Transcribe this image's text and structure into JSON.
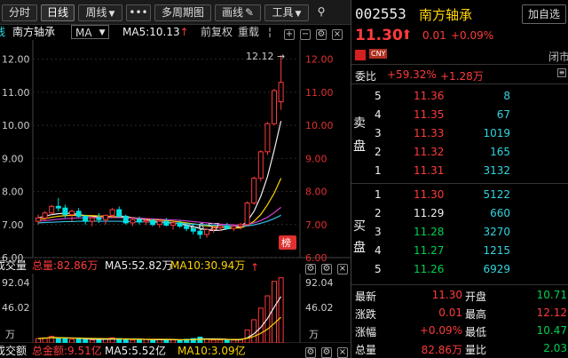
{
  "toolbar": {
    "buttons": [
      "分时",
      "日线",
      "周线",
      "•••",
      "多周期图",
      "画线",
      "工具"
    ]
  },
  "chart_header": {
    "stock_name": "南方轴承",
    "indicator": "MA",
    "ma5": "MA5:10.13",
    "fq": "前复权",
    "overlay": "重载"
  },
  "kline": {
    "price_labels": [
      "12.00",
      "11.00",
      "10.00",
      "9.00",
      "8.00",
      "7.00",
      "6.00"
    ],
    "high_label": "12.12",
    "low_label": "6.57",
    "badge": "榜"
  },
  "volume": {
    "title": "成交量",
    "total": "总量:82.86万",
    "ma5": "MA5:52.82万",
    "ma10": "MA10:30.94万",
    "labels": [
      "92.04",
      "46.02",
      "万"
    ]
  },
  "amount": {
    "title": "成交额",
    "total": "总金额:9.51亿",
    "ma5": "MA5:5.52亿",
    "ma10": "MA10:3.09亿"
  },
  "quote": {
    "code": "002553",
    "name": "南方轴承",
    "add_button": "加自选",
    "price": "11.30",
    "change": "0.01",
    "change_pct": "+0.09%",
    "currency": "CNY",
    "status": "闭市",
    "weibi_label": "委比",
    "weibi_pct": "+59.32%",
    "weibi_diff": "+1.28万",
    "sell_label": [
      "卖",
      "盘"
    ],
    "buy_label": [
      "买",
      "盘"
    ],
    "asks": [
      {
        "level": "5",
        "price": "11.36",
        "vol": "8"
      },
      {
        "level": "4",
        "price": "11.35",
        "vol": "67"
      },
      {
        "level": "3",
        "price": "11.33",
        "vol": "1019"
      },
      {
        "level": "2",
        "price": "11.32",
        "vol": "165"
      },
      {
        "level": "1",
        "price": "11.31",
        "vol": "3132"
      }
    ],
    "bids": [
      {
        "level": "1",
        "price": "11.30",
        "vol": "5122"
      },
      {
        "level": "2",
        "price": "11.29",
        "vol": "660"
      },
      {
        "level": "3",
        "price": "11.28",
        "vol": "3270"
      },
      {
        "level": "4",
        "price": "11.27",
        "vol": "1215"
      },
      {
        "level": "5",
        "price": "11.26",
        "vol": "6929"
      }
    ],
    "stats": [
      {
        "l1": "最新",
        "v1": "11.30",
        "l2": "开盘",
        "v2": "10.71"
      },
      {
        "l1": "涨跌",
        "v1": "0.01",
        "l2": "最高",
        "v2": "12.12"
      },
      {
        "l1": "涨幅",
        "v1": "+0.09%",
        "l2": "最低",
        "v2": "10.47"
      },
      {
        "l1": "总量",
        "v1": "82.86万",
        "l2": "量比",
        "v2": "2.03"
      }
    ]
  },
  "chart_data": {
    "type": "candlestick",
    "y_range": [
      6.0,
      12.5
    ],
    "candles": [
      [
        7.1,
        7.3,
        7.0,
        7.2
      ],
      [
        7.2,
        7.4,
        7.1,
        7.35
      ],
      [
        7.35,
        7.6,
        7.3,
        7.55
      ],
      [
        7.55,
        7.8,
        7.4,
        7.5
      ],
      [
        7.5,
        7.6,
        7.2,
        7.3
      ],
      [
        7.3,
        7.45,
        7.1,
        7.4
      ],
      [
        7.4,
        7.5,
        7.2,
        7.25
      ],
      [
        7.25,
        7.3,
        7.0,
        7.1
      ],
      [
        7.1,
        7.25,
        6.95,
        7.2
      ],
      [
        7.2,
        7.35,
        7.05,
        7.15
      ],
      [
        7.15,
        7.3,
        7.0,
        7.28
      ],
      [
        7.28,
        7.5,
        7.2,
        7.45
      ],
      [
        7.45,
        7.55,
        7.2,
        7.25
      ],
      [
        7.25,
        7.3,
        7.0,
        7.05
      ],
      [
        7.05,
        7.2,
        6.95,
        7.15
      ],
      [
        7.15,
        7.25,
        7.0,
        7.08
      ],
      [
        7.08,
        7.2,
        6.98,
        7.12
      ],
      [
        7.12,
        7.18,
        6.95,
        7.0
      ],
      [
        7.0,
        7.15,
        6.9,
        7.1
      ],
      [
        7.1,
        7.2,
        6.95,
        6.98
      ],
      [
        6.98,
        7.1,
        6.85,
        7.05
      ],
      [
        7.05,
        7.12,
        6.9,
        6.95
      ],
      [
        6.95,
        7.05,
        6.8,
        6.88
      ],
      [
        6.88,
        7.0,
        6.7,
        6.8
      ],
      [
        6.8,
        6.95,
        6.57,
        6.7
      ],
      [
        6.7,
        6.9,
        6.6,
        6.85
      ],
      [
        6.85,
        6.95,
        6.75,
        6.9
      ],
      [
        6.9,
        7.0,
        6.8,
        6.95
      ],
      [
        6.95,
        7.05,
        6.85,
        6.88
      ],
      [
        6.88,
        6.98,
        6.8,
        6.95
      ],
      [
        6.95,
        7.05,
        6.85,
        7.0
      ],
      [
        7.0,
        7.7,
        6.95,
        7.65
      ],
      [
        7.65,
        8.45,
        7.6,
        8.4
      ],
      [
        8.4,
        9.25,
        8.3,
        9.2
      ],
      [
        9.2,
        10.1,
        9.1,
        10.05
      ],
      [
        10.05,
        11.1,
        10.0,
        11.05
      ],
      [
        10.71,
        12.12,
        10.47,
        11.3
      ]
    ],
    "volumes": [
      6,
      7,
      9,
      7,
      6,
      5,
      6,
      5,
      4,
      5,
      5,
      7,
      6,
      5,
      4,
      4,
      5,
      4,
      5,
      4,
      4,
      4,
      5,
      6,
      8,
      5,
      4,
      4,
      4,
      4,
      5,
      18,
      32,
      48,
      65,
      85,
      90
    ],
    "ma5": [
      7.2,
      7.25,
      7.3,
      7.33,
      7.34,
      7.34,
      7.3,
      7.27,
      7.25,
      7.22,
      7.2,
      7.22,
      7.25,
      7.25,
      7.2,
      7.17,
      7.15,
      7.1,
      7.09,
      7.06,
      7.05,
      7.02,
      6.98,
      6.94,
      6.88,
      6.84,
      6.82,
      6.83,
      6.87,
      6.91,
      6.94,
      7.1,
      7.4,
      7.85,
      8.45,
      9.25,
      10.13
    ],
    "ma10": [
      7.15,
      7.18,
      7.22,
      7.25,
      7.27,
      7.28,
      7.28,
      7.27,
      7.27,
      7.26,
      7.25,
      7.24,
      7.23,
      7.22,
      7.21,
      7.19,
      7.17,
      7.15,
      7.14,
      7.12,
      7.1,
      7.08,
      7.05,
      7.02,
      6.99,
      6.96,
      6.94,
      6.92,
      6.91,
      6.9,
      6.9,
      6.97,
      7.1,
      7.3,
      7.6,
      7.95,
      8.4
    ],
    "ma20": [
      7.1,
      7.12,
      7.14,
      7.16,
      7.18,
      7.19,
      7.2,
      7.21,
      7.21,
      7.21,
      7.21,
      7.21,
      7.21,
      7.2,
      7.2,
      7.19,
      7.18,
      7.17,
      7.16,
      7.15,
      7.14,
      7.13,
      7.11,
      7.09,
      7.07,
      7.05,
      7.03,
      7.01,
      7.0,
      6.99,
      6.98,
      7.0,
      7.05,
      7.12,
      7.22,
      7.36,
      7.52
    ],
    "ma60": [
      7.05,
      7.06,
      7.07,
      7.08,
      7.09,
      7.09,
      7.1,
      7.1,
      7.1,
      7.1,
      7.1,
      7.1,
      7.1,
      7.09,
      7.09,
      7.08,
      7.08,
      7.07,
      7.06,
      7.05,
      7.04,
      7.03,
      7.02,
      7.01,
      7.0,
      6.99,
      6.98,
      6.97,
      6.96,
      6.95,
      6.95,
      6.96,
      6.99,
      7.04,
      7.1,
      7.18,
      7.28
    ]
  }
}
